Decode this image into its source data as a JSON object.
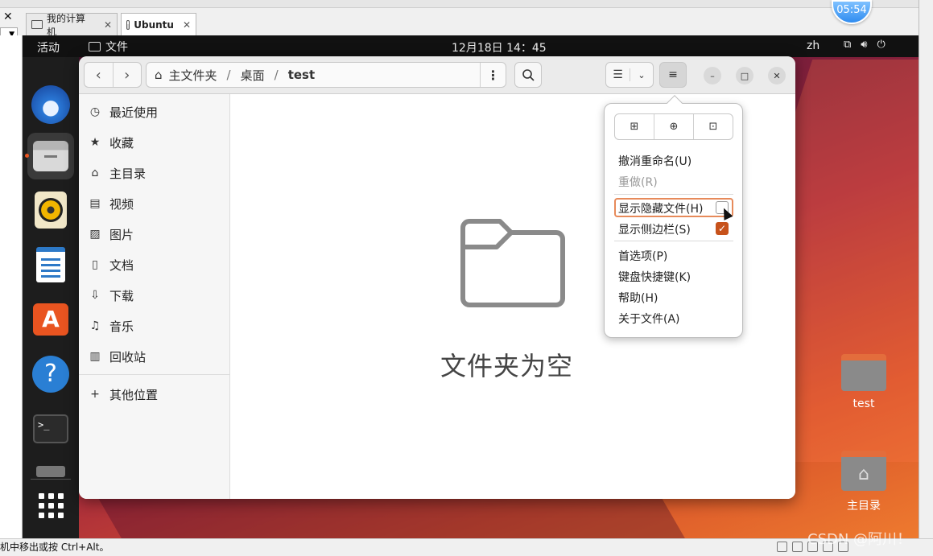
{
  "host": {
    "close_symbol": "✕",
    "tabs": [
      {
        "label": "我的计算机",
        "close": "✕"
      },
      {
        "label": "Ubuntu",
        "close": "✕"
      }
    ],
    "clock_badge": "05:54",
    "status_text": "机中移出或按 Ctrl+Alt。",
    "watermark": "CSDN @阿川！"
  },
  "topbar": {
    "activities": "活动",
    "app_name": "文件",
    "clock": "12月18日 14：45",
    "lang": "zh",
    "icons": [
      "network-icon",
      "volume-icon",
      "power-icon"
    ]
  },
  "dock": {
    "items": [
      "thunderbird-icon",
      "files-icon",
      "rhythmbox-icon",
      "writer-icon",
      "app-center-icon",
      "help-icon",
      "terminal-icon",
      "drive-icon",
      "show-apps-icon"
    ],
    "help_glyph": "?",
    "store_glyph": "A",
    "terminal_glyph": ">_"
  },
  "desktop_icons": [
    {
      "label": "test"
    },
    {
      "label": "主目录"
    }
  ],
  "window": {
    "path": {
      "root": "主文件夹",
      "sep": "/",
      "mid": "桌面",
      "current": "test"
    },
    "sidebar": [
      {
        "label": "最近使用",
        "icon": "clock-icon",
        "glyph": "◷"
      },
      {
        "label": "收藏",
        "icon": "star-icon",
        "glyph": "★"
      },
      {
        "label": "主目录",
        "icon": "home-icon",
        "glyph": "⌂"
      },
      {
        "label": "视频",
        "icon": "video-icon",
        "glyph": "▤"
      },
      {
        "label": "图片",
        "icon": "image-icon",
        "glyph": "▨"
      },
      {
        "label": "文档",
        "icon": "document-icon",
        "glyph": "▯"
      },
      {
        "label": "下载",
        "icon": "download-icon",
        "glyph": "⇩"
      },
      {
        "label": "音乐",
        "icon": "music-icon",
        "glyph": "♫"
      },
      {
        "label": "回收站",
        "icon": "trash-icon",
        "glyph": "▥"
      },
      {
        "label": "其他位置",
        "icon": "plus-icon",
        "glyph": "+"
      }
    ],
    "empty_text": "文件夹为空"
  },
  "menu": {
    "items": [
      {
        "label": "撤消重命名(U)",
        "enabled": true
      },
      {
        "label": "重做(R)",
        "enabled": false
      },
      {
        "label": "显示隐藏文件(H)",
        "checked": false
      },
      {
        "label": "显示侧边栏(S)",
        "checked": true
      },
      {
        "label": "首选项(P)",
        "enabled": true
      },
      {
        "label": "键盘快捷键(K)",
        "enabled": true
      },
      {
        "label": "帮助(H)",
        "enabled": true
      },
      {
        "label": "关于文件(A)",
        "enabled": true
      }
    ],
    "check_glyph": "✓"
  },
  "colors": {
    "accent": "#e95420",
    "checkbox": "#c7521b"
  }
}
